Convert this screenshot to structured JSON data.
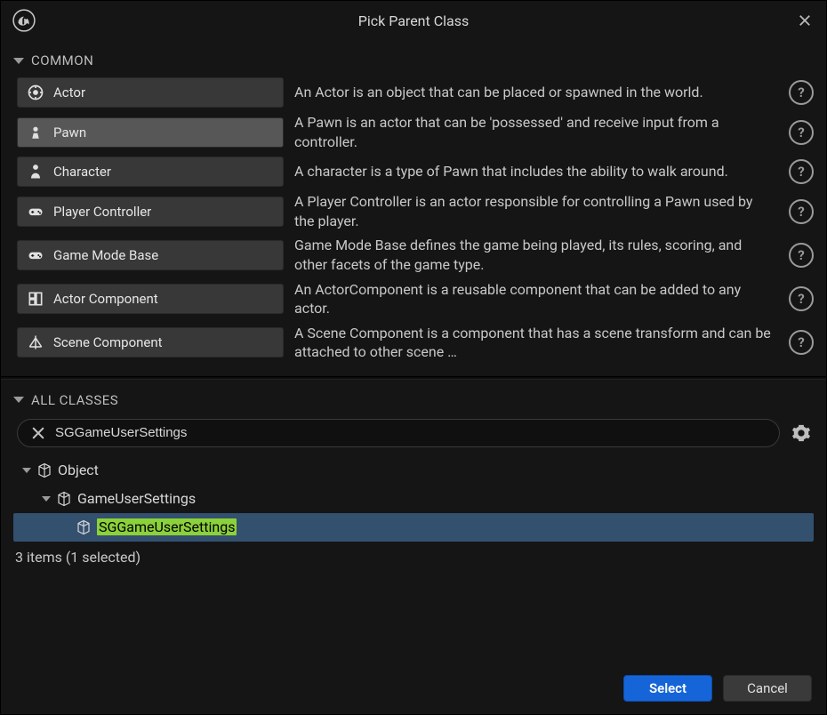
{
  "title": "Pick Parent Class",
  "sections": {
    "common_label": "COMMON",
    "all_classes_label": "ALL CLASSES"
  },
  "common_classes": [
    {
      "name": "Actor",
      "description": "An Actor is an object that can be placed or spawned in the world.",
      "icon": "actor"
    },
    {
      "name": "Pawn",
      "description": "A Pawn is an actor that can be 'possessed' and receive input from a controller.",
      "icon": "pawn"
    },
    {
      "name": "Character",
      "description": "A character is a type of Pawn that includes the ability to walk around.",
      "icon": "character"
    },
    {
      "name": "Player Controller",
      "description": "A Player Controller is an actor responsible for controlling a Pawn used by the player.",
      "icon": "controller"
    },
    {
      "name": "Game Mode Base",
      "description": "Game Mode Base defines the game being played, its rules, scoring, and other facets of the game type.",
      "icon": "controller"
    },
    {
      "name": "Actor Component",
      "description": "An ActorComponent is a reusable component that can be added to any actor.",
      "icon": "component"
    },
    {
      "name": "Scene Component",
      "description": "A Scene Component is a component that has a scene transform and can be attached to other scene …",
      "icon": "scene"
    }
  ],
  "search": {
    "value": "SGGameUserSettings"
  },
  "tree": [
    {
      "label": "Object",
      "indent": 0,
      "expanded": true,
      "selected": false,
      "highlighted": false
    },
    {
      "label": "GameUserSettings",
      "indent": 1,
      "expanded": true,
      "selected": false,
      "highlighted": false
    },
    {
      "label": "SGGameUserSettings",
      "indent": 2,
      "expanded": false,
      "selected": true,
      "highlighted": true
    }
  ],
  "status": "3 items (1 selected)",
  "buttons": {
    "select": "Select",
    "cancel": "Cancel"
  },
  "hovered_common_index": 1
}
